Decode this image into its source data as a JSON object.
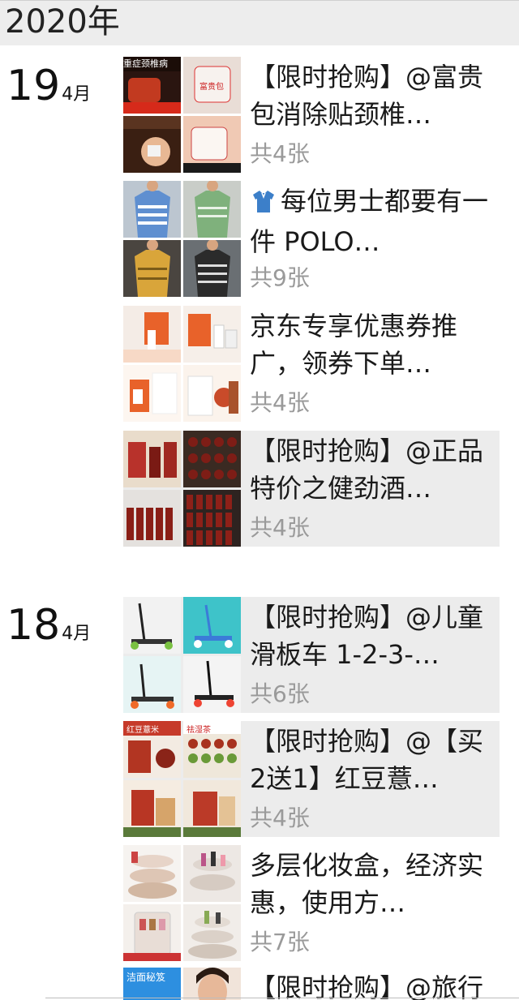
{
  "year_header": "2020年",
  "groups": [
    {
      "day": "19",
      "month": "4月"
    },
    {
      "day": "18",
      "month": "4月"
    }
  ],
  "posts": [
    {
      "text": "【限时抢购】@富贵包消除贴颈椎…",
      "count": "共4张"
    },
    {
      "text": "每位男士都要有一件 POLO…",
      "count": "共9张",
      "icon": "polo-shirt-icon"
    },
    {
      "text": "京东专享优惠券推广，领券下单…",
      "count": "共4张"
    },
    {
      "text": "【限时抢购】@正品特价之健劲酒…",
      "count": "共4张"
    },
    {
      "text": "【限时抢购】@儿童滑板车 1-2-3-…",
      "count": "共6张"
    },
    {
      "text": "【限时抢购】@【买2送1】红豆薏…",
      "count": "共4张"
    },
    {
      "text": "多层化妆盒，经济实惠，使用方…",
      "count": "共7张"
    }
  ],
  "partial_post": {
    "text": "【限时抢购】@旅行"
  },
  "thumb_labels": {
    "p0": [
      "重症颈椎病",
      "富贵包"
    ],
    "p5": [
      "红豆薏米",
      "祛湿茶"
    ],
    "partial": [
      "洁面秘笈"
    ]
  },
  "colors": {
    "shaded_row": "#ececec",
    "year_bar": "#ededed",
    "count_text": "#9a9a9a",
    "polo_icon": "#3c7fc9"
  }
}
